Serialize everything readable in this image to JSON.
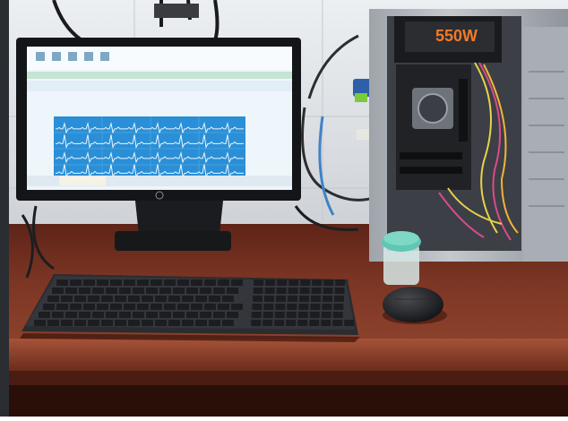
{
  "psu": {
    "label": "550W"
  },
  "ecg": {
    "lead_rows": 4,
    "colors": {
      "screen": "#eef6fb",
      "trace_bg": "#2a8fd6",
      "trace_line": "#e9f7ff"
    }
  },
  "colors": {
    "wall": "#d9dde2",
    "desk": "#7a3524",
    "desk_edge": "#9a4a34",
    "keyboard": "#2b2c30",
    "case_metal": "#b7bcc2",
    "cup_lid": "#5fc7b4"
  },
  "icons": [
    "hp-logo",
    "mouse",
    "keyboard",
    "specimen-cup",
    "power-supply"
  ]
}
